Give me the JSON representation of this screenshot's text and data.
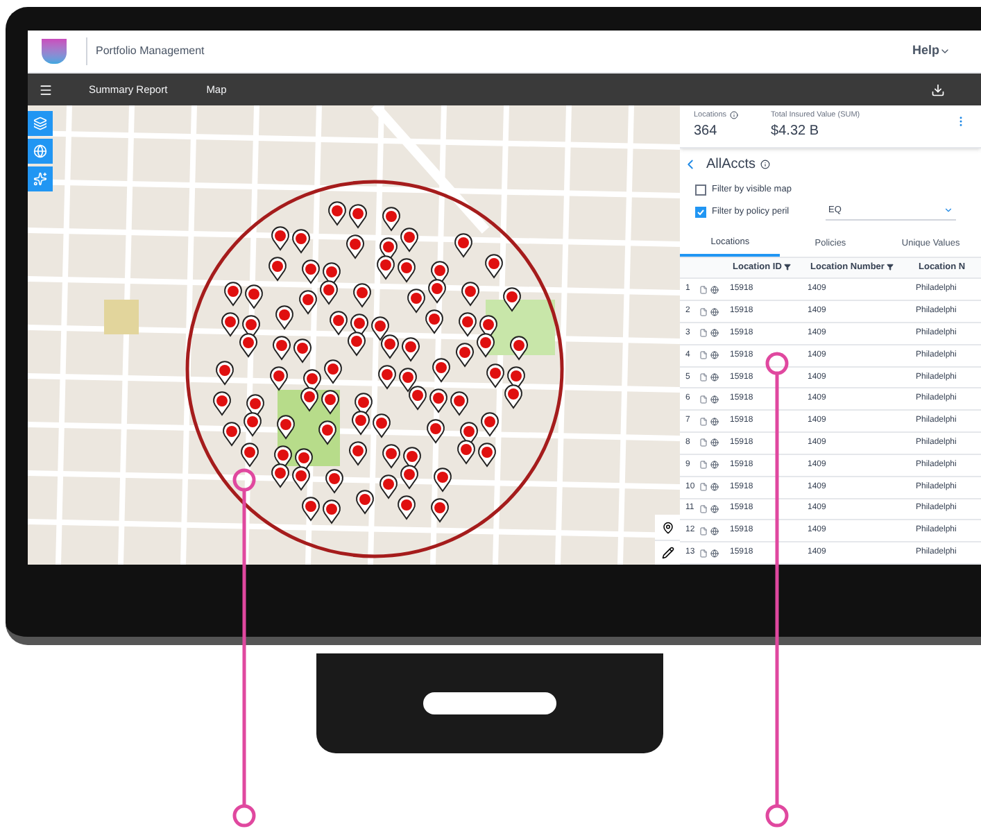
{
  "header": {
    "app_title": "Portfolio Management",
    "help": "Help"
  },
  "nav": {
    "items": [
      {
        "label": "Summary Report"
      },
      {
        "label": "Map"
      }
    ]
  },
  "summary": {
    "locations_label": "Locations",
    "locations_value": "364",
    "tiv_label": "Total Insured Value (SUM)",
    "tiv_value": "$4.32 B"
  },
  "panel": {
    "title": "AllAccts",
    "filters": [
      {
        "label": "Filter by visible map",
        "checked": false
      },
      {
        "label": "Filter by policy peril",
        "checked": true
      }
    ],
    "peril": "EQ"
  },
  "tabs": [
    {
      "label": "Locations",
      "selected": true
    },
    {
      "label": "Policies",
      "selected": false
    },
    {
      "label": "Unique Values",
      "selected": false
    }
  ],
  "table": {
    "columns": [
      "Location ID",
      "Location Number",
      "Location N"
    ],
    "rows": [
      {
        "n": "1",
        "id": "15918",
        "num": "1409",
        "city": "Philadelphi"
      },
      {
        "n": "2",
        "id": "15918",
        "num": "1409",
        "city": "Philadelphi"
      },
      {
        "n": "3",
        "id": "15918",
        "num": "1409",
        "city": "Philadelphi"
      },
      {
        "n": "4",
        "id": "15918",
        "num": "1409",
        "city": "Philadelphi"
      },
      {
        "n": "5",
        "id": "15918",
        "num": "1409",
        "city": "Philadelphi"
      },
      {
        "n": "6",
        "id": "15918",
        "num": "1409",
        "city": "Philadelphi"
      },
      {
        "n": "7",
        "id": "15918",
        "num": "1409",
        "city": "Philadelphi"
      },
      {
        "n": "8",
        "id": "15918",
        "num": "1409",
        "city": "Philadelphi"
      },
      {
        "n": "9",
        "id": "15918",
        "num": "1409",
        "city": "Philadelphi"
      },
      {
        "n": "10",
        "id": "15918",
        "num": "1409",
        "city": "Philadelphi"
      },
      {
        "n": "11",
        "id": "15918",
        "num": "1409",
        "city": "Philadelphi"
      },
      {
        "n": "12",
        "id": "15918",
        "num": "1409",
        "city": "Philadelphi"
      },
      {
        "n": "13",
        "id": "15918",
        "num": "1409",
        "city": "Philadelphi"
      }
    ]
  }
}
